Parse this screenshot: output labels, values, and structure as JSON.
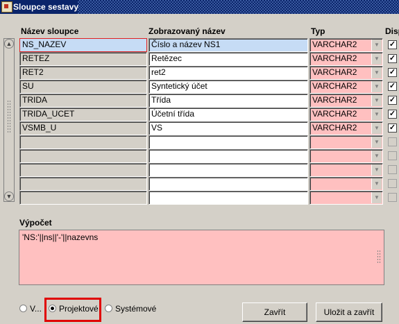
{
  "window": {
    "title": "Sloupce sestavy"
  },
  "headers": {
    "name": "Název sloupce",
    "display_name": "Zobrazovaný název",
    "type": "Typ",
    "disp": "Disp"
  },
  "rows": [
    {
      "name": "NS_NAZEV",
      "display": "Číslo a název NS1",
      "type": "VARCHAR2",
      "checked": true
    },
    {
      "name": "RETEZ",
      "display": "Retězec",
      "type": "VARCHAR2",
      "checked": true
    },
    {
      "name": "RET2",
      "display": "ret2",
      "type": "VARCHAR2",
      "checked": true
    },
    {
      "name": "SU",
      "display": "Syntetický účet",
      "type": "VARCHAR2",
      "checked": true
    },
    {
      "name": "TRIDA",
      "display": "Třída",
      "type": "VARCHAR2",
      "checked": true
    },
    {
      "name": "TRIDA_UCET",
      "display": "Účetní třída",
      "type": "VARCHAR2",
      "checked": true
    },
    {
      "name": "VSMB_U",
      "display": "VS",
      "type": "VARCHAR2",
      "checked": true
    },
    {
      "name": "",
      "display": "",
      "type": "",
      "checked": false
    },
    {
      "name": "",
      "display": "",
      "type": "",
      "checked": false
    },
    {
      "name": "",
      "display": "",
      "type": "",
      "checked": false
    },
    {
      "name": "",
      "display": "",
      "type": "",
      "checked": false
    },
    {
      "name": "",
      "display": "",
      "type": "",
      "checked": false
    }
  ],
  "calc": {
    "label": "Výpočet",
    "value": "'NS:'||ns||'-'||nazevns"
  },
  "radios": [
    {
      "label": "V...",
      "selected": false
    },
    {
      "label": "Projektové",
      "selected": true
    },
    {
      "label": "Systémové",
      "selected": false
    }
  ],
  "buttons": {
    "close": "Zavřít",
    "save_close": "Uložit a zavřít"
  },
  "colors": {
    "title_bar": "#0a246a",
    "required_field": "#ffc0c0",
    "selected_row": "#c6dcf5",
    "highlight": "#e00000"
  }
}
